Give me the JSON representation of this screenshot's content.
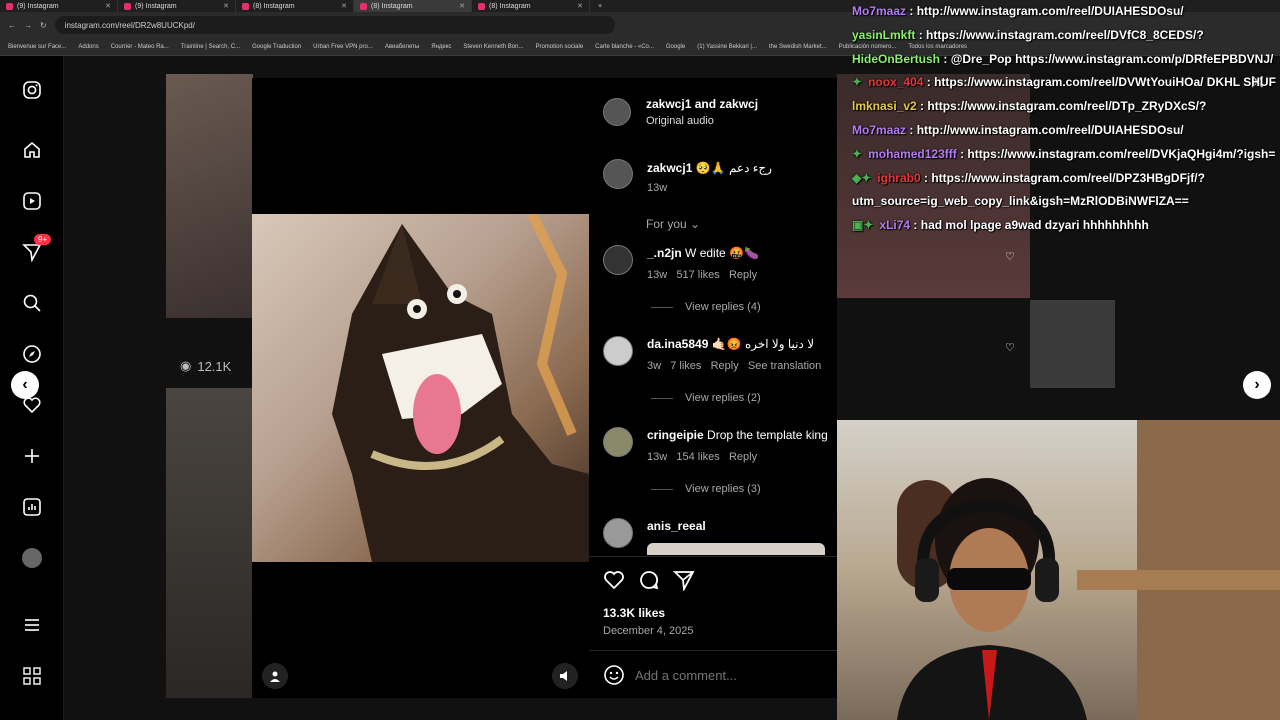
{
  "browser": {
    "tabs": [
      {
        "label": "(9) Instagram",
        "active": false
      },
      {
        "label": "(9) Instagram",
        "active": false
      },
      {
        "label": "(8) Instagram",
        "active": false
      },
      {
        "label": "(8) Instagram",
        "active": true
      },
      {
        "label": "(8) Instagram",
        "active": false
      }
    ],
    "url": "instagram.com/reel/DR2w8UUCKpd/",
    "bookmarks": [
      "Bienvenue sur Face...",
      "Addons",
      "Courrier - Mateo Ra...",
      "Trainline | Search, C...",
      "Google Traduction",
      "Urban Free VPN pro...",
      "Авиабилеты",
      "Яндекс",
      "Steven Kenneth Bon...",
      "Promotion sociale",
      "Carte blanche - «Co...",
      "Google",
      "(1) Yassine Bekkari |...",
      "the Swedish Market...",
      "Publicación número...",
      "Todos los marcadores"
    ]
  },
  "sidebar": {
    "badge_count": "9+"
  },
  "feed": {
    "views_count": "12.1K"
  },
  "post": {
    "header_users": "zakwcj1 and zakwcj",
    "audio": "Original audio",
    "caption_user": "zakwcj1",
    "caption_text": "🥺🙏 رجء دعم",
    "caption_time": "13w",
    "sort_label": "For you",
    "comments": [
      {
        "user": "_.n2jn",
        "text": "W edite 🤬🍆",
        "time": "13w",
        "likes": "517 likes",
        "reply": "Reply",
        "translate": "",
        "view_replies": "View replies (4)"
      },
      {
        "user": "da.ina5849",
        "text": "🤙🏻😡 لا دنيا ولا اخره",
        "time": "3w",
        "likes": "7 likes",
        "reply": "Reply",
        "translate": "See translation",
        "view_replies": "View replies (2)"
      },
      {
        "user": "cringeipie",
        "text": "Drop the template king",
        "time": "13w",
        "likes": "154 likes",
        "reply": "Reply",
        "translate": "",
        "view_replies": "View replies (3)"
      },
      {
        "user": "anis_reeal",
        "text": "",
        "time": "",
        "likes": "",
        "reply": "",
        "translate": "",
        "view_replies": ""
      }
    ],
    "likes_total": "13.3K likes",
    "date": "December 4, 2025",
    "comment_placeholder": "Add a comment..."
  },
  "chat": [
    {
      "user": "Mo7maaz",
      "color": "#b57cf5",
      "badges": "",
      "message": "http://www.instagram.com/reel/DUIAHESDOsu/"
    },
    {
      "user": "yasinLmkft",
      "color": "#8cf26a",
      "badges": "",
      "message": "https://www.instagram.com/reel/DVfC8_8CEDS/?"
    },
    {
      "user": "HideOnBertush",
      "color": "#8cf26a",
      "badges": "",
      "message": "@Dre_Pop https://www.instagram.com/p/DRfeEPBDVNJ/"
    },
    {
      "user": "noox_404",
      "color": "#e3373e",
      "badges": "✦",
      "message": "https://www.instagram.com/reel/DVWtYouiHOa/ DKHL SHUF"
    },
    {
      "user": "lmknasi_v2",
      "color": "#e6c94a",
      "badges": "",
      "message": "https://www.instagram.com/reel/DTp_ZRyDXcS/?"
    },
    {
      "user": "Mo7maaz",
      "color": "#b57cf5",
      "badges": "",
      "message": "http://www.instagram.com/reel/DUIAHESDOsu/"
    },
    {
      "user": "mohamed123fff",
      "color": "#b57cf5",
      "badges": "✦",
      "message": "https://www.instagram.com/reel/DVKjaQHgi4m/?igsh="
    },
    {
      "user": "ighrab0",
      "color": "#e3373e",
      "badges": "◆✦",
      "message": "https://www.instagram.com/reel/DPZ3HBgDFjf/?"
    },
    {
      "user": "",
      "color": "#ffffff",
      "badges": "",
      "message": "utm_source=ig_web_copy_link&igsh=MzRlODBiNWFlZA=="
    },
    {
      "user": "xLi74",
      "color": "#b57cf5",
      "badges": "▣✦",
      "message": "had mol lpage a9wad dzyari hhhhhhhhh"
    }
  ]
}
